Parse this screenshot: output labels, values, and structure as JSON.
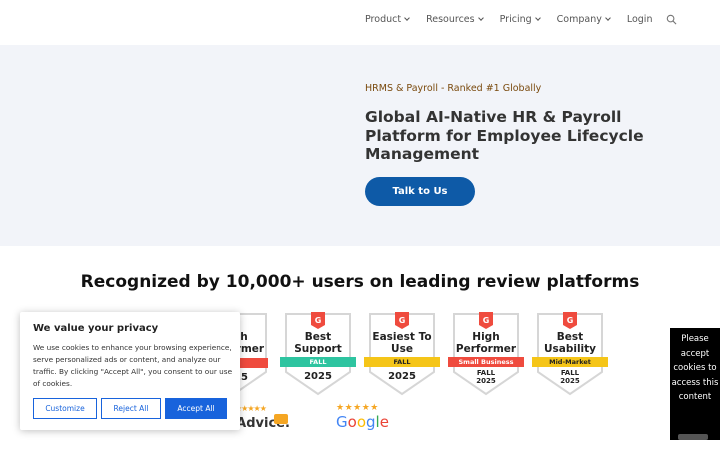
{
  "nav": {
    "items": [
      "Product",
      "Resources",
      "Pricing",
      "Company"
    ],
    "login": "Login",
    "search_icon": "search-icon"
  },
  "hero": {
    "tag": "HRMS & Payroll - Ranked #1 Globally",
    "title": "Global AI-Native HR & Payroll Platform for Employee Lifecycle Management",
    "cta": "Talk to Us"
  },
  "recognition": {
    "title": "Recognized by 10,000+ users on leading review platforms",
    "badges": [
      {
        "title": "High Performer",
        "ribbon": "",
        "year": "2025"
      },
      {
        "title": "Best Support",
        "ribbon": "FALL",
        "year": "2025",
        "ribbon_color": "#2ec4a0"
      },
      {
        "title": "Easiest To Use",
        "ribbon": "FALL",
        "year": "2025",
        "ribbon_color": "#f5c518"
      },
      {
        "title": "High Performer",
        "ribbon": "Small Business",
        "season": "FALL",
        "year": "2025",
        "ribbon_color": "#ef4b3e"
      },
      {
        "title": "Best Usability",
        "ribbon": "Mid-Market",
        "season": "FALL",
        "year": "2025",
        "ribbon_color": "#f5c518"
      }
    ],
    "logos": {
      "software_advice": "SoftwareAdvice.",
      "google": "Google"
    }
  },
  "cookie": {
    "title": "We value your privacy",
    "text": "We use cookies to enhance your browsing experience, serve personalized ads or content, and analyze our traffic. By clicking \"Accept All\", you consent to our use of cookies.",
    "customize": "Customize",
    "reject": "Reject All",
    "accept": "Accept All"
  },
  "side_notice": {
    "text": "Please accept cookies to access this content"
  },
  "colors": {
    "brand_blue": "#0e5aa7",
    "cookie_blue": "#1863dc",
    "g2_red": "#ef4b3e",
    "hero_bg": "#f2f4f9"
  }
}
